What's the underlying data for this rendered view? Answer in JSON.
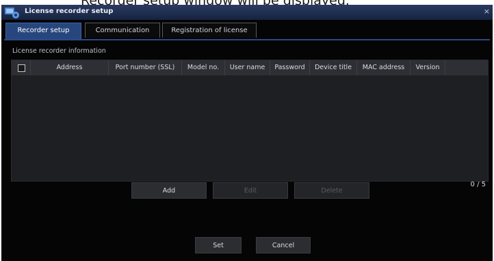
{
  "caption": "Recorder setup window will be displayed.",
  "window": {
    "title": "License recorder setup",
    "close_glyph": "×"
  },
  "tabs": [
    {
      "label": "Recorder setup",
      "active": true
    },
    {
      "label": "Communication",
      "active": false
    },
    {
      "label": "Registration of license",
      "active": false
    }
  ],
  "section_label": "License recorder information",
  "table": {
    "columns": [
      "Address",
      "Port number (SSL)",
      "Model no.",
      "User name",
      "Password",
      "Device title",
      "MAC address",
      "Version"
    ],
    "rows": [],
    "select_all_checked": false
  },
  "actions": {
    "add": "Add",
    "edit": "Edit",
    "delete": "Delete",
    "count": "0 / 5"
  },
  "footer": {
    "set": "Set",
    "cancel": "Cancel"
  },
  "colors": {
    "window_bg": "#050505",
    "active_tab": "#27467e",
    "table_bg": "#1e1f23"
  },
  "icons": {
    "app": "recorder-app-icon",
    "close": "close-icon",
    "checkbox": "checkbox-icon"
  }
}
